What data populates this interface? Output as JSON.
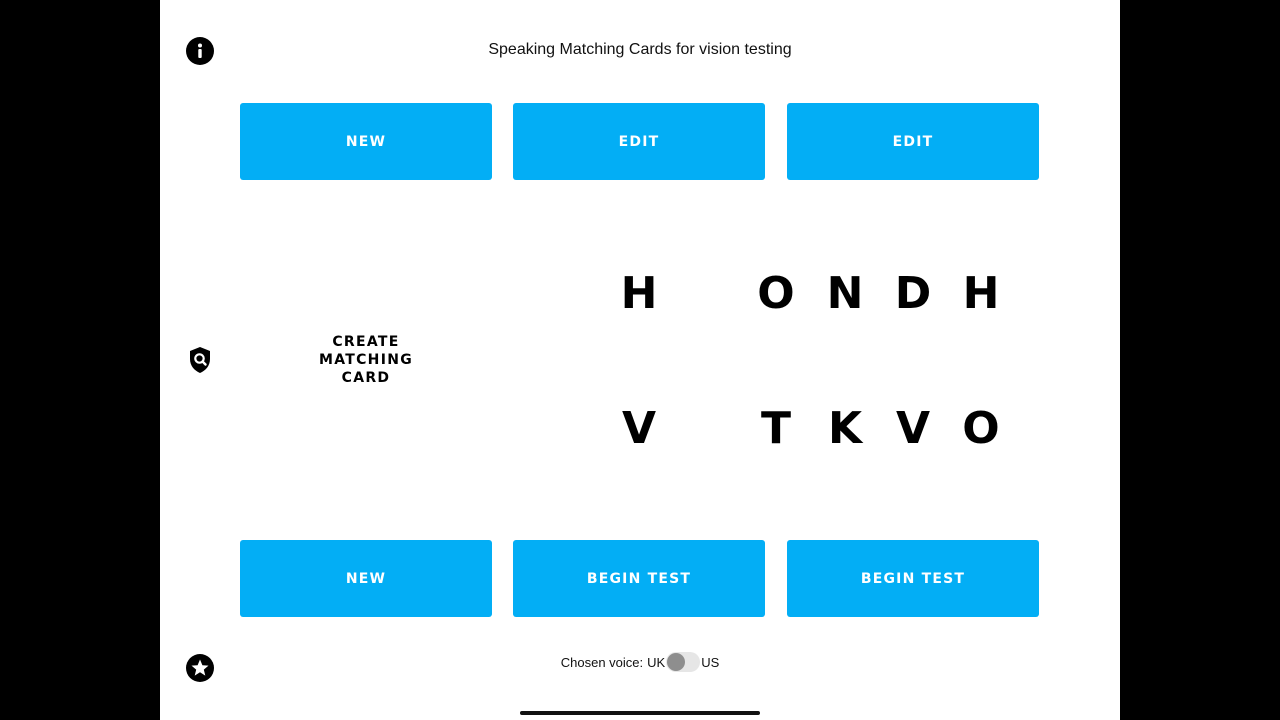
{
  "header": {
    "title": "Speaking Matching Cards for vision testing",
    "info_icon": "info-icon"
  },
  "top_buttons": [
    {
      "label": "NEW"
    },
    {
      "label": "EDIT"
    },
    {
      "label": "EDIT"
    }
  ],
  "create_card": {
    "lines": [
      "CREATE",
      "MATCHING",
      "CARD"
    ],
    "icon": "shield-search-icon"
  },
  "cards": {
    "card1": {
      "row1": [
        "H"
      ],
      "row2": [
        "V"
      ]
    },
    "card2": {
      "row1": [
        "O"
      ],
      "row2": [
        "T"
      ]
    },
    "card3": {
      "row1": [
        "N",
        "D",
        "H"
      ],
      "row2": [
        "K",
        "V",
        "O"
      ]
    }
  },
  "bottom_buttons": [
    {
      "label": "NEW"
    },
    {
      "label": "BEGIN TEST"
    },
    {
      "label": "BEGIN TEST"
    }
  ],
  "voice": {
    "label": "Chosen voice:",
    "option_left": "UK",
    "option_right": "US",
    "selected": "UK"
  },
  "footer": {
    "star_icon": "star-icon"
  },
  "colors": {
    "button_blue": "#03aef5",
    "background": "#ffffff",
    "letterbox": "#000000"
  }
}
